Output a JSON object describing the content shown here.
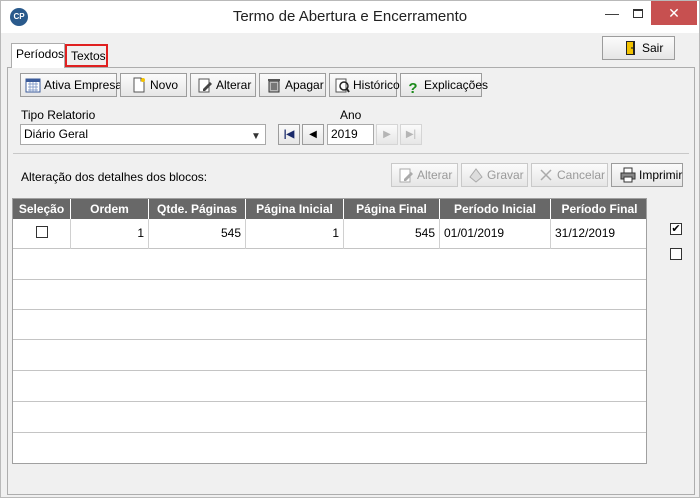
{
  "window": {
    "title": "Termo de Abertura e Encerramento",
    "app_icon_text": "CP",
    "minimize": "—",
    "close": "✕"
  },
  "tabs": [
    {
      "label": "Períodos",
      "selected": true
    },
    {
      "label": "Textos",
      "selected": false,
      "highlighted": true
    }
  ],
  "sair_label": "Sair",
  "toolbar": {
    "ativa_empresa": "Ativa Empresa",
    "novo": "Novo",
    "alterar": "Alterar",
    "apagar": "Apagar",
    "historico": "Histórico",
    "explicacoes": "Explicações"
  },
  "filters": {
    "tipo_relatorio_label": "Tipo Relatorio",
    "tipo_relatorio_value": "Diário Geral",
    "ano_label": "Ano",
    "ano_value": "2019"
  },
  "blocks": {
    "label": "Alteração dos detalhes dos blocos:",
    "alterar": "Alterar",
    "gravar": "Gravar",
    "cancelar": "Cancelar",
    "imprimir": "Imprimir"
  },
  "grid": {
    "columns": [
      "Seleção",
      "Ordem",
      "Qtde. Páginas",
      "Página Inicial",
      "Página Final",
      "Período Inicial",
      "Período Final"
    ],
    "rows": [
      {
        "selecao": false,
        "ordem": "1",
        "qtde_paginas": "545",
        "pagina_inicial": "1",
        "pagina_final": "545",
        "periodo_inicial": "01/01/2019",
        "periodo_final": "31/12/2019"
      }
    ]
  },
  "side_checks": [
    true,
    false
  ],
  "icons": {
    "ativa_empresa": "calendar-icon",
    "novo": "new-document-icon",
    "alterar": "edit-icon",
    "apagar": "trash-icon",
    "historico": "history-icon",
    "explicacoes": "help-icon",
    "sair": "exit-door-icon",
    "imprimir": "printer-icon"
  },
  "colors": {
    "grid_header": "#686868",
    "tab_highlight": "#e02020",
    "close_button": "#c75050"
  }
}
